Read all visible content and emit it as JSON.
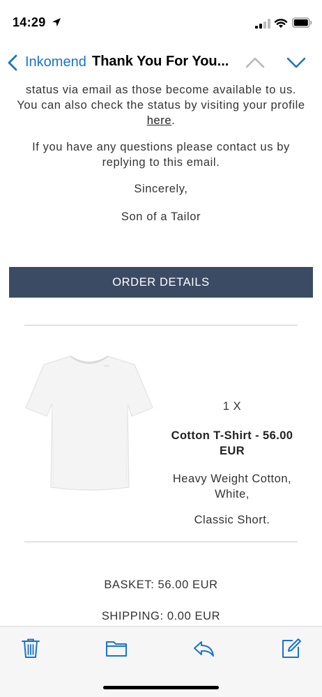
{
  "status_bar": {
    "time": "14:29"
  },
  "nav": {
    "back_label": "Inkomend",
    "title": "Thank You For You..."
  },
  "email": {
    "paragraph1_before_link": "status via email as those become available to us. You can also check the status by visiting your profile ",
    "link_text": "here",
    "paragraph1_after_link": ".",
    "paragraph2": "If you have any questions please contact us by replying to this email.",
    "signoff": "Sincerely,",
    "signature": "Son of a Tailor",
    "order_header": "ORDER DETAILS",
    "product": {
      "quantity": "1 X",
      "name": "Cotton T-Shirt - 56.00 EUR",
      "description": "Heavy Weight Cotton, White,",
      "style": "Classic Short."
    },
    "basket": "BASKET: 56.00 EUR",
    "shipping": "SHIPPING: 0.00 EUR"
  },
  "colors": {
    "accent": "#1a73c9",
    "order_header_bg": "#3b4b63",
    "toolbar_bg": "#f6f6f7"
  },
  "icons": {
    "status": [
      "location-arrow-icon",
      "cellular-signal-icon",
      "wifi-icon",
      "battery-icon"
    ],
    "nav": [
      "back-chevron-icon",
      "previous-message-icon",
      "next-message-icon"
    ],
    "toolbar": [
      "trash-icon",
      "folder-icon",
      "reply-icon",
      "compose-icon"
    ]
  }
}
